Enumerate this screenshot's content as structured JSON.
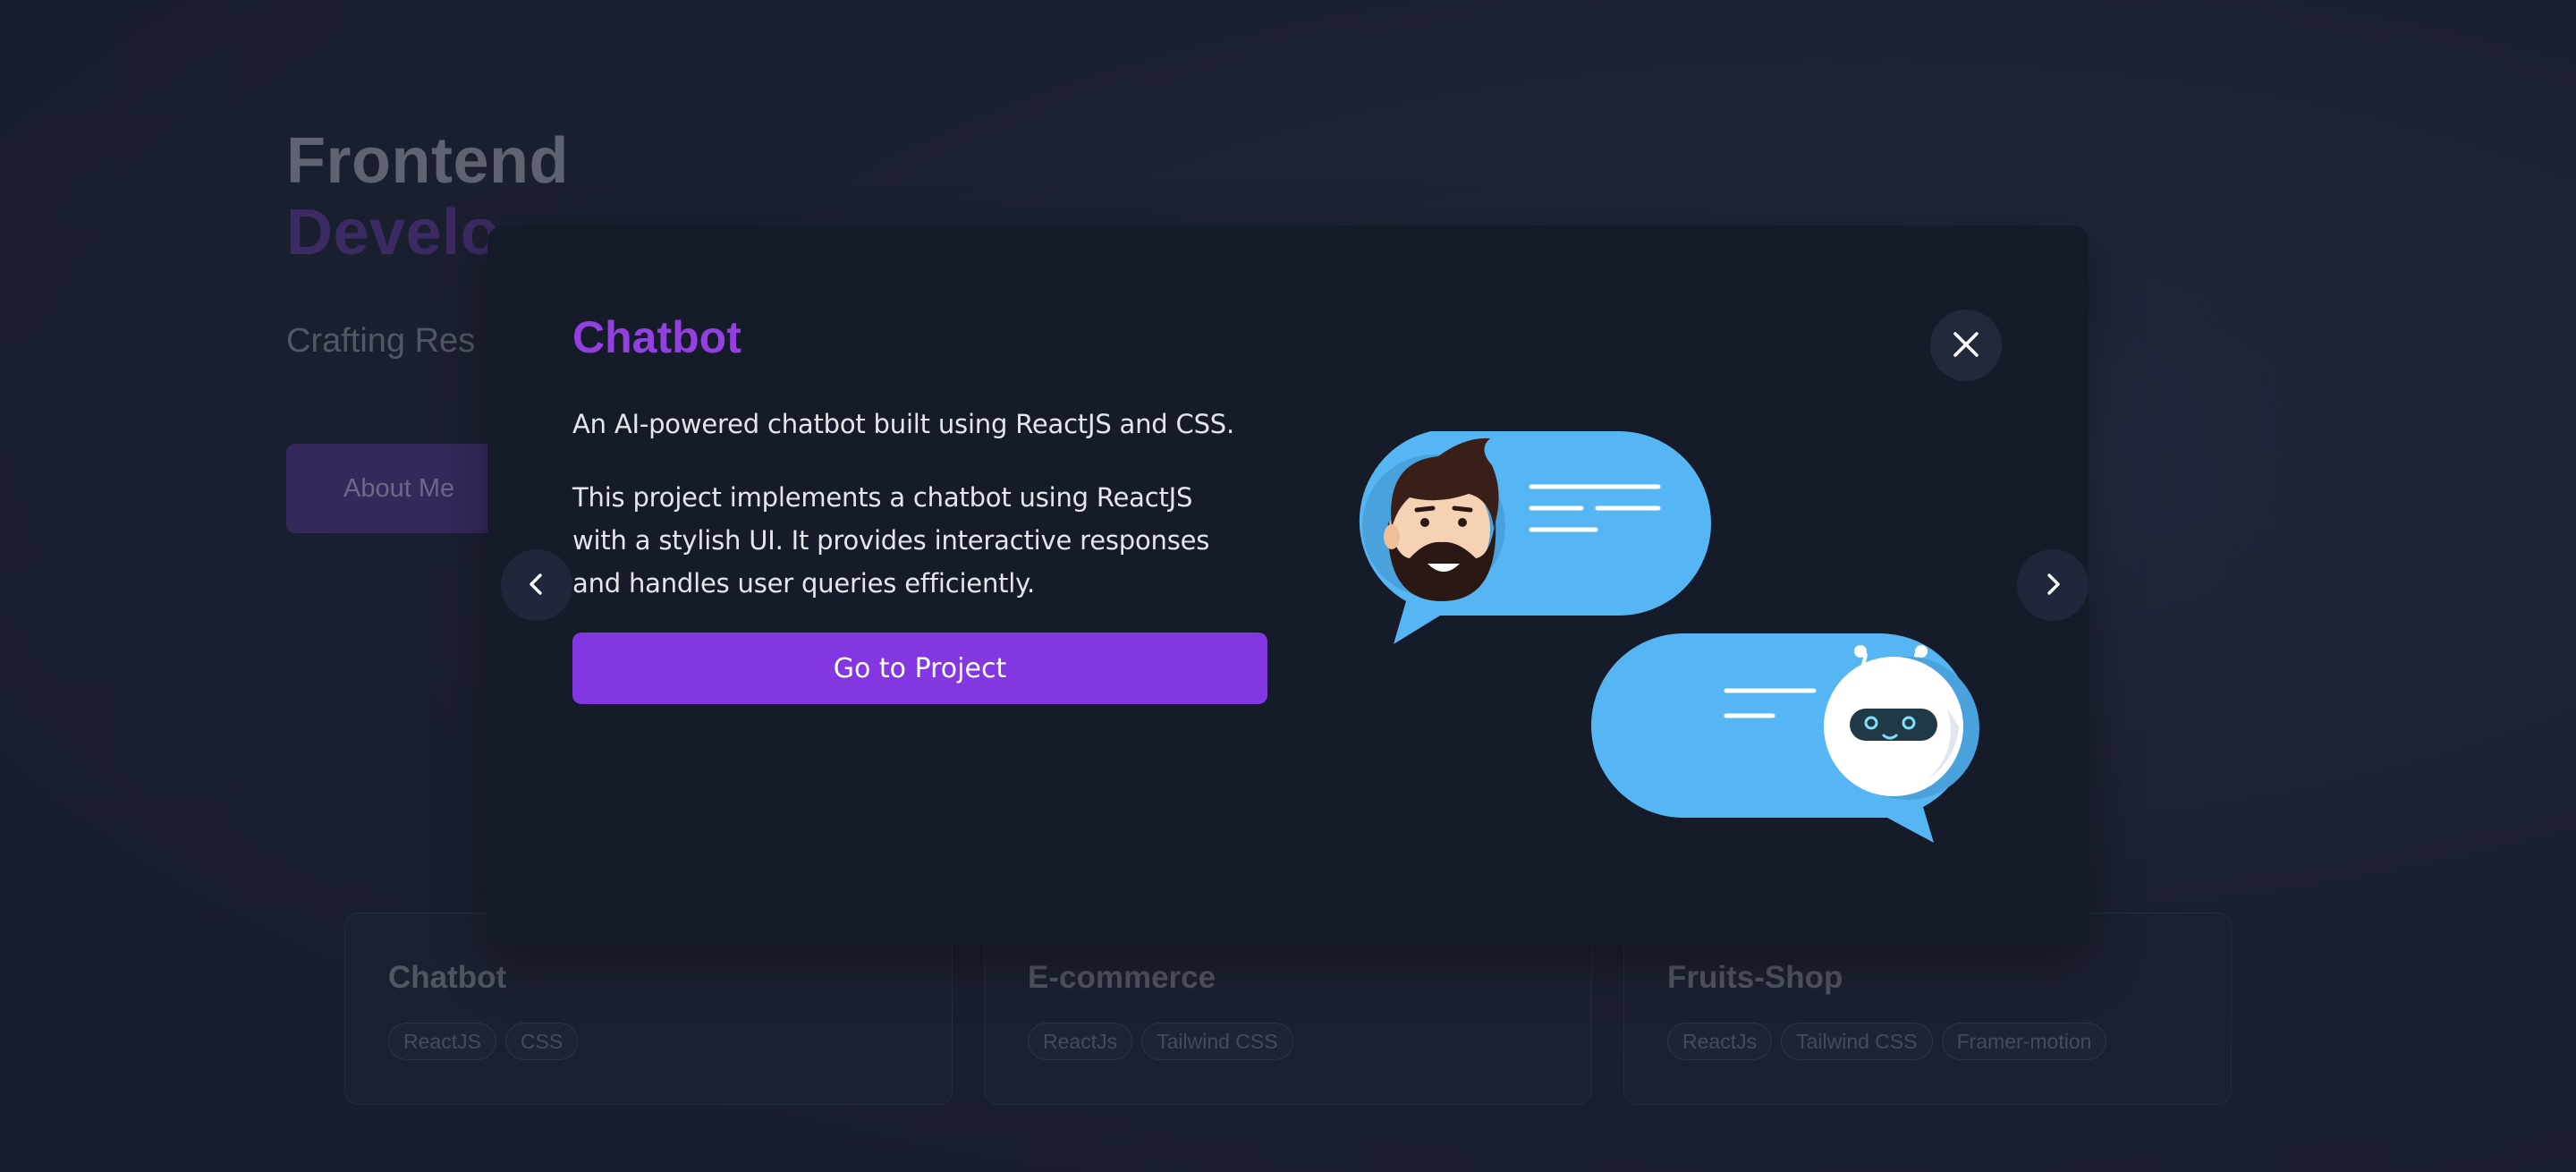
{
  "hero": {
    "title_line1": "Frontend",
    "title_line2": "Develo",
    "subtitle": "Crafting Res",
    "about_button": "About Me"
  },
  "projects": [
    {
      "title": "Chatbot",
      "tags": [
        "ReactJS",
        "CSS"
      ]
    },
    {
      "title": "E-commerce",
      "tags": [
        "ReactJs",
        "Tailwind CSS"
      ]
    },
    {
      "title": "Fruits-Shop",
      "tags": [
        "ReactJs",
        "Tailwind CSS",
        "Framer-motion"
      ]
    }
  ],
  "modal": {
    "title": "Chatbot",
    "short_description": "An AI-powered chatbot built using ReactJS and CSS.",
    "long_description": "This project implements a chatbot using ReactJS with a stylish UI. It provides interactive responses and handles user queries efficiently.",
    "cta_label": "Go to Project",
    "close_icon": "close-icon",
    "prev_icon": "chevron-left-icon",
    "next_icon": "chevron-right-icon",
    "illustration": "chat-bubbles-human-robot"
  },
  "colors": {
    "accent": "#8237e0",
    "title_purple": "#9340e0",
    "modal_bg": "#161b29",
    "page_bg": "#1f2537",
    "bubble_blue": "#56b6f4"
  }
}
